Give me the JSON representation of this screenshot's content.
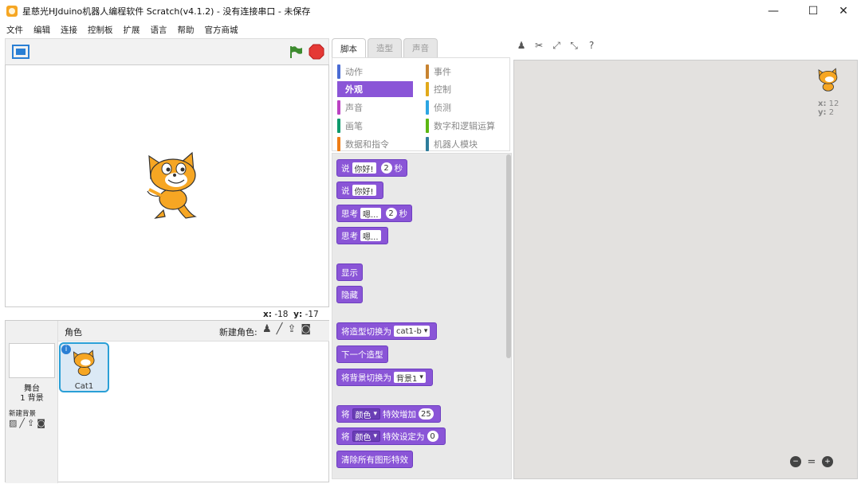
{
  "window": {
    "title": "星慈光HJduino机器人编程软件 Scratch(v4.1.2) - 没有连接串口 - 未保存",
    "minimize": "—",
    "maximize": "☐",
    "close": "✕"
  },
  "menu": [
    "文件",
    "编辑",
    "连接",
    "控制板",
    "扩展",
    "语言",
    "帮助",
    "官方商城"
  ],
  "stage": {
    "x_label": "x:",
    "x_value": "-18",
    "y_label": "y:",
    "y_value": "-17"
  },
  "sprites": {
    "header": "角色",
    "new_sprite": "新建角色:",
    "stage_label": "舞台",
    "stage_count": "1 背景",
    "new_backdrop": "新建背景",
    "sprite_name": "Cat1"
  },
  "tabs": [
    "脚本",
    "造型",
    "声音"
  ],
  "categories": {
    "left": [
      {
        "label": "动作",
        "color": "#4a6cd4"
      },
      {
        "label": "外观",
        "color": "#8a55d7"
      },
      {
        "label": "声音",
        "color": "#bb42c3"
      },
      {
        "label": "画笔",
        "color": "#0e9a6c"
      },
      {
        "label": "数据和指令",
        "color": "#ee7d16"
      }
    ],
    "right": [
      {
        "label": "事件",
        "color": "#c88330"
      },
      {
        "label": "控制",
        "color": "#e1a91a"
      },
      {
        "label": "侦测",
        "color": "#2ca5e2"
      },
      {
        "label": "数字和逻辑运算",
        "color": "#5cb712"
      },
      {
        "label": "机器人模块",
        "color": "#2e7d9b"
      }
    ]
  },
  "blocks": {
    "say_secs": {
      "a": "说",
      "b": "你好!",
      "c": "2",
      "d": "秒"
    },
    "say": {
      "a": "说",
      "b": "你好!"
    },
    "think_secs": {
      "a": "思考",
      "b": "嗯...",
      "c": "2",
      "d": "秒"
    },
    "think": {
      "a": "思考",
      "b": "嗯..."
    },
    "show": "显示",
    "hide": "隐藏",
    "switch_costume": {
      "a": "将造型切换为",
      "b": "cat1-b"
    },
    "next_costume": "下一个造型",
    "switch_backdrop": {
      "a": "将背景切换为",
      "b": "背景1"
    },
    "change_effect": {
      "a": "将",
      "b": "颜色",
      "c": "特效增加",
      "d": "25"
    },
    "set_effect": {
      "a": "将",
      "b": "颜色",
      "c": "特效设定为",
      "d": "0"
    },
    "clear_effects": "清除所有图形特效"
  },
  "scripts_corner": {
    "x_label": "x:",
    "x_value": "12",
    "y_label": "y:",
    "y_value": "2"
  },
  "colors": {
    "looks": "#8a55d7",
    "stop": "#e53935",
    "flag": "#3d8b2f"
  }
}
